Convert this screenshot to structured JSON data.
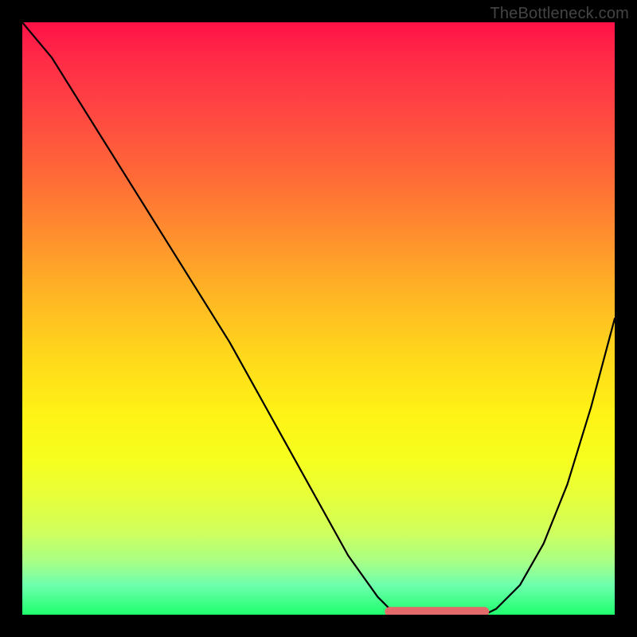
{
  "watermark": "TheBottleneck.com",
  "chart_data": {
    "type": "line",
    "title": "",
    "xlabel": "",
    "ylabel": "",
    "xlim": [
      0,
      1
    ],
    "ylim": [
      0,
      1
    ],
    "series": [
      {
        "name": "bottleneck-curve",
        "x": [
          0.0,
          0.05,
          0.1,
          0.15,
          0.2,
          0.25,
          0.3,
          0.35,
          0.4,
          0.45,
          0.5,
          0.55,
          0.6,
          0.62,
          0.64,
          0.66,
          0.7,
          0.74,
          0.78,
          0.8,
          0.84,
          0.88,
          0.92,
          0.96,
          1.0
        ],
        "y": [
          1.0,
          0.94,
          0.86,
          0.78,
          0.7,
          0.62,
          0.54,
          0.46,
          0.37,
          0.28,
          0.19,
          0.1,
          0.03,
          0.01,
          0.0,
          0.0,
          0.0,
          0.0,
          0.0,
          0.01,
          0.05,
          0.12,
          0.22,
          0.35,
          0.5
        ]
      },
      {
        "name": "optimal-flat-segment",
        "x": [
          0.62,
          0.78
        ],
        "y": [
          0.005,
          0.005
        ]
      }
    ],
    "gradient_stops": [
      {
        "pos": 0.0,
        "color": "#ff1147"
      },
      {
        "pos": 0.5,
        "color": "#ffd71c"
      },
      {
        "pos": 0.75,
        "color": "#f6ff1f"
      },
      {
        "pos": 1.0,
        "color": "#1eff6e"
      }
    ]
  }
}
